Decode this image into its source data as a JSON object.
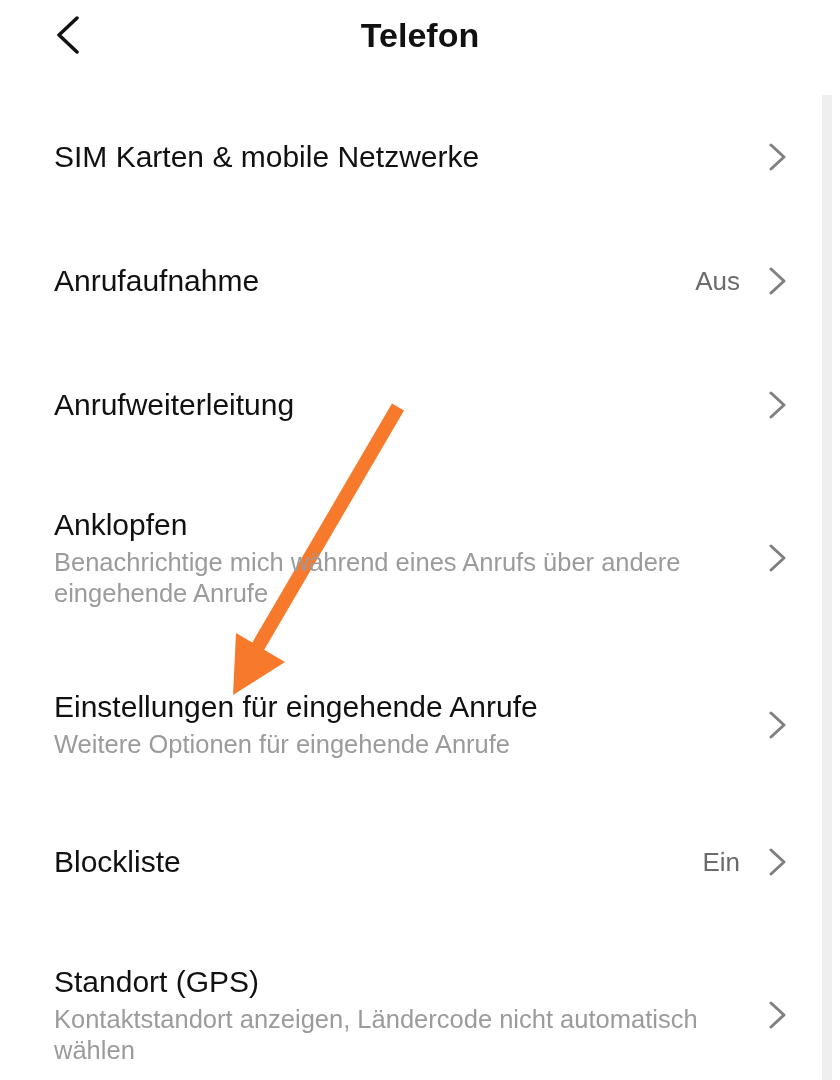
{
  "header": {
    "title": "Telefon"
  },
  "items": [
    {
      "title": "SIM Karten & mobile Netzwerke"
    },
    {
      "title": "Anrufaufnahme",
      "value": "Aus"
    },
    {
      "title": "Anrufweiterleitung"
    },
    {
      "title": "Anklopfen",
      "subtitle": "Benachrichtige mich während eines Anrufs über andere eingehende Anrufe"
    },
    {
      "title": "Einstellungen für eingehende Anrufe",
      "subtitle": "Weitere Optionen für eingehende Anrufe"
    },
    {
      "title": "Blockliste",
      "value": "Ein"
    },
    {
      "title": "Standort (GPS)",
      "subtitle": "Kontaktstandort anzeigen, Ländercode nicht automatisch wählen"
    }
  ],
  "annotation": {
    "kind": "arrow"
  }
}
